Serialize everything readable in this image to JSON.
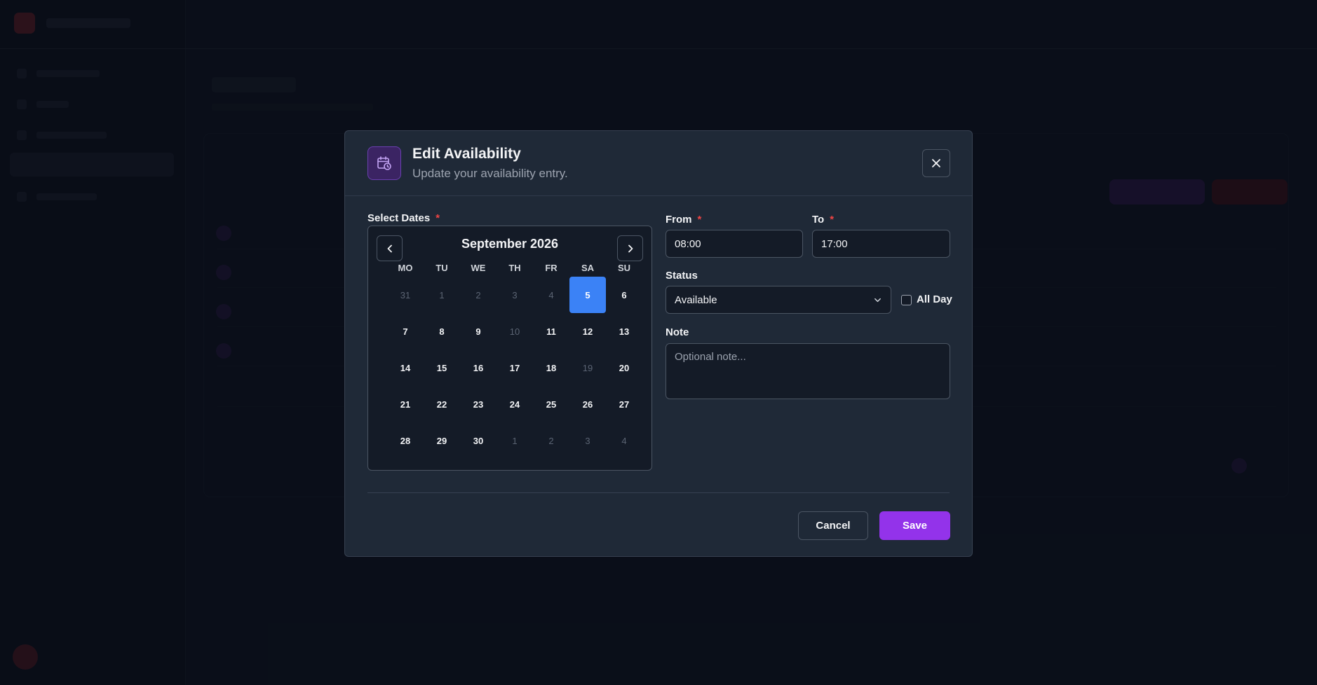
{
  "modal": {
    "title": "Edit Availability",
    "subtitle": "Update your availability entry.",
    "icon": "calendar-clock-icon",
    "close_icon": "close-icon"
  },
  "dates": {
    "label": "Select Dates",
    "required_mark": "*"
  },
  "calendar": {
    "month_label": "September 2026",
    "prev_icon": "chevron-left-icon",
    "next_icon": "chevron-right-icon",
    "weekdays": [
      "MO",
      "TU",
      "WE",
      "TH",
      "FR",
      "SA",
      "SU"
    ],
    "weeks": [
      [
        {
          "d": "31",
          "s": "muted"
        },
        {
          "d": "1",
          "s": "disabled"
        },
        {
          "d": "2",
          "s": "disabled"
        },
        {
          "d": "3",
          "s": "disabled"
        },
        {
          "d": "4",
          "s": "disabled"
        },
        {
          "d": "5",
          "s": "selected"
        },
        {
          "d": "6",
          "s": "normal"
        }
      ],
      [
        {
          "d": "7",
          "s": "normal"
        },
        {
          "d": "8",
          "s": "normal"
        },
        {
          "d": "9",
          "s": "normal"
        },
        {
          "d": "10",
          "s": "disabled"
        },
        {
          "d": "11",
          "s": "normal"
        },
        {
          "d": "12",
          "s": "normal"
        },
        {
          "d": "13",
          "s": "normal"
        }
      ],
      [
        {
          "d": "14",
          "s": "normal"
        },
        {
          "d": "15",
          "s": "normal"
        },
        {
          "d": "16",
          "s": "normal"
        },
        {
          "d": "17",
          "s": "normal"
        },
        {
          "d": "18",
          "s": "normal"
        },
        {
          "d": "19",
          "s": "disabled"
        },
        {
          "d": "20",
          "s": "normal"
        }
      ],
      [
        {
          "d": "21",
          "s": "normal"
        },
        {
          "d": "22",
          "s": "normal"
        },
        {
          "d": "23",
          "s": "normal"
        },
        {
          "d": "24",
          "s": "normal"
        },
        {
          "d": "25",
          "s": "normal"
        },
        {
          "d": "26",
          "s": "normal"
        },
        {
          "d": "27",
          "s": "normal"
        }
      ],
      [
        {
          "d": "28",
          "s": "normal"
        },
        {
          "d": "29",
          "s": "normal"
        },
        {
          "d": "30",
          "s": "normal"
        },
        {
          "d": "1",
          "s": "muted"
        },
        {
          "d": "2",
          "s": "muted"
        },
        {
          "d": "3",
          "s": "muted"
        },
        {
          "d": "4",
          "s": "muted"
        }
      ]
    ],
    "selected_color": "#3b82f6"
  },
  "time": {
    "from_label": "From",
    "from_value": "08:00",
    "to_label": "To",
    "to_value": "17:00",
    "required_mark": "*"
  },
  "status": {
    "label": "Status",
    "value": "Available",
    "dropdown_icon": "chevron-down-icon",
    "all_day_label": "All Day",
    "all_day_checked": false
  },
  "note": {
    "label": "Note",
    "placeholder": "Optional note..."
  },
  "footer": {
    "cancel_label": "Cancel",
    "save_label": "Save"
  },
  "colors": {
    "accent": "#9333ea",
    "required": "#ef4444",
    "modal_bg": "#1f2937"
  }
}
